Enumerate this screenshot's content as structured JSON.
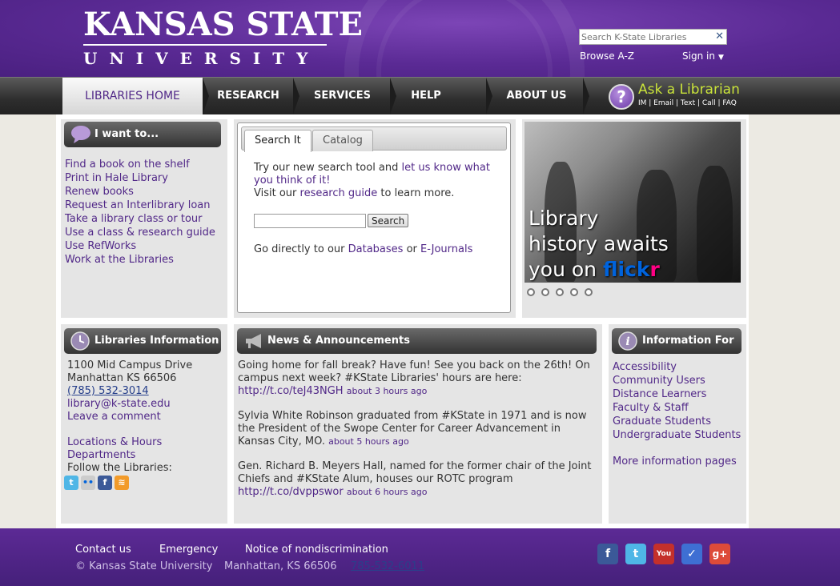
{
  "header": {
    "logo_top": "KANSAS STATE",
    "logo_bottom": "UNIVERSITY",
    "search_placeholder": "Search K-State Libraries",
    "browse_az": "Browse A-Z",
    "sign_in": "Sign in"
  },
  "nav": {
    "items": [
      "LIBRARIES HOME",
      "RESEARCH",
      "SERVICES",
      "HELP",
      "ABOUT US"
    ],
    "ask_title": "Ask a Librarian",
    "ask_sub": "IM | Email | Text | Call | FAQ"
  },
  "iwant": {
    "title": "I want to...",
    "links": [
      "Find a book on the shelf",
      "Print in Hale Library",
      "Renew books",
      "Request an Interlibrary loan",
      "Take a library class or tour",
      "Use a class & research guide",
      "Use RefWorks",
      "Work at the Libraries"
    ]
  },
  "search": {
    "tab_search": "Search It",
    "tab_catalog": "Catalog",
    "line1_pre": "Try our new search tool and ",
    "line1_link": "let us know what you think of it!",
    "line2_pre": "Visit our ",
    "line2_link": "research guide",
    "line2_post": " to learn more.",
    "button": "Search",
    "direct_pre": "Go directly to our ",
    "direct_link1": "Databases",
    "direct_mid": " or ",
    "direct_link2": "E-Journals"
  },
  "flickr": {
    "line1": "Library",
    "line2": "history awaits",
    "line3": "you on",
    "brand_a": "flick",
    "brand_b": "r"
  },
  "libinfo": {
    "title": "Libraries Information",
    "address1": "1100 Mid Campus Drive",
    "address2": "Manhattan KS 66506",
    "phone": "(785) 532-3014",
    "email": "library@k-state.edu",
    "comment": "Leave a comment",
    "locations": "Locations & Hours",
    "departments": "Departments",
    "follow": "Follow the Libraries:"
  },
  "news": {
    "title": "News & Announcements",
    "items": [
      {
        "text": "Going home for fall break? Have fun! See you back on the 26th! On campus next week? #KState Libraries' hours are here:",
        "link": "http://t.co/teJ43NGH",
        "when": "about 3 hours ago"
      },
      {
        "text": "Sylvia White Robinson graduated from #KState in 1971 and is now the President of the Swope Center for Career Advancement in Kansas City, MO.",
        "link": "",
        "when": "about 5 hours ago"
      },
      {
        "text": "Gen. Richard B. Meyers Hall, named for the former chair of the Joint Chiefs and #KState Alum, houses our ROTC program",
        "link": "http://t.co/dvppswor",
        "when": "about 6 hours ago"
      }
    ]
  },
  "infofor": {
    "title": "Information For",
    "links": [
      "Accessibility",
      "Community Users",
      "Distance Learners",
      "Faculty & Staff",
      "Graduate Students",
      "Undergraduate Students"
    ],
    "more": "More information pages"
  },
  "footer": {
    "contact": "Contact us",
    "emergency": "Emergency",
    "notice": "Notice of nondiscrimination",
    "copyright": "© Kansas State University",
    "city": "Manhattan, KS 66506",
    "phone": "785-532-6011"
  },
  "colors": {
    "brand_purple": "#512888",
    "ask_green": "#c9e33a"
  }
}
